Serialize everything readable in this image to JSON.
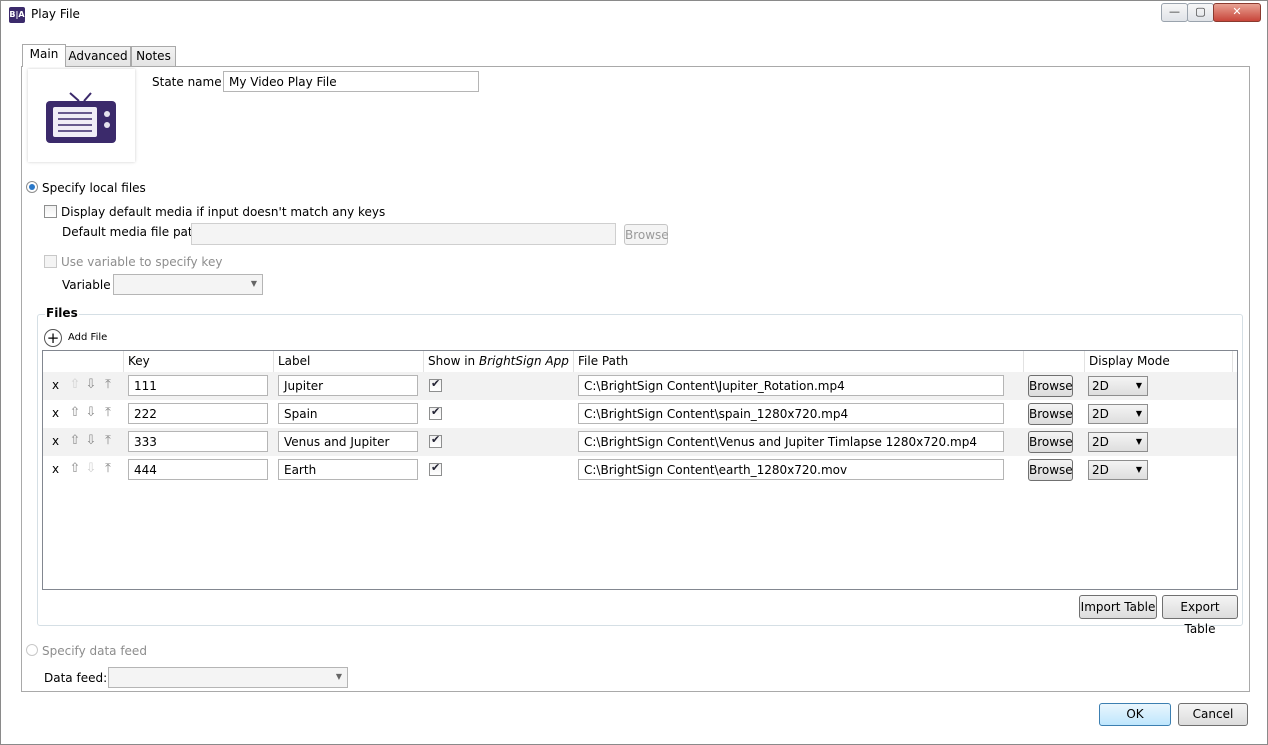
{
  "window": {
    "title": "Play File",
    "app_icon_text": "B|A",
    "minimize_glyph": "—",
    "maximize_glyph": "▢",
    "close_glyph": "✕"
  },
  "tabs": [
    {
      "label": "Main",
      "active": true
    },
    {
      "label": "Advanced",
      "active": false
    },
    {
      "label": "Notes",
      "active": false
    }
  ],
  "state": {
    "label": "State name:",
    "value": "My Video Play File",
    "icon": "tv-icon"
  },
  "local_files": {
    "radio_label": "Specify local files",
    "selected": true,
    "default_media_checkbox": "Display default media if input doesn't match any keys",
    "default_media_path_label": "Default media file path",
    "default_media_path_value": "",
    "browse_label": "Browse",
    "use_variable_checkbox": "Use variable to specify key",
    "variable_label": "Variable",
    "variable_value": ""
  },
  "files": {
    "group_label": "Files",
    "add_file_label": "Add File",
    "columns": {
      "key": "Key",
      "label": "Label",
      "show_prefix": "Show in ",
      "show_app": "BrightSign App",
      "file_path": "File Path",
      "display_mode": "Display Mode"
    },
    "delete_glyph": "x",
    "row_browse_label": "Browse",
    "rows": [
      {
        "key": "111",
        "label": "Jupiter",
        "show": true,
        "path": "C:\\BrightSign Content\\Jupiter_Rotation.mp4",
        "mode": "2D"
      },
      {
        "key": "222",
        "label": "Spain",
        "show": true,
        "path": "C:\\BrightSign Content\\spain_1280x720.mp4",
        "mode": "2D"
      },
      {
        "key": "333",
        "label": "Venus and Jupiter",
        "show": true,
        "path": "C:\\BrightSign Content\\Venus and Jupiter Timlapse 1280x720.mp4",
        "mode": "2D"
      },
      {
        "key": "444",
        "label": "Earth",
        "show": true,
        "path": "C:\\BrightSign Content\\earth_1280x720.mov",
        "mode": "2D"
      }
    ],
    "import_label": "Import Table",
    "export_label": "Export Table"
  },
  "data_feed": {
    "radio_label": "Specify data feed",
    "selected": false,
    "feed_label": "Data feed:",
    "feed_value": ""
  },
  "footer": {
    "ok_label": "OK",
    "cancel_label": "Cancel"
  },
  "colors": {
    "accent": "#2a78c8",
    "tv_icon": "#3b2a6b"
  }
}
